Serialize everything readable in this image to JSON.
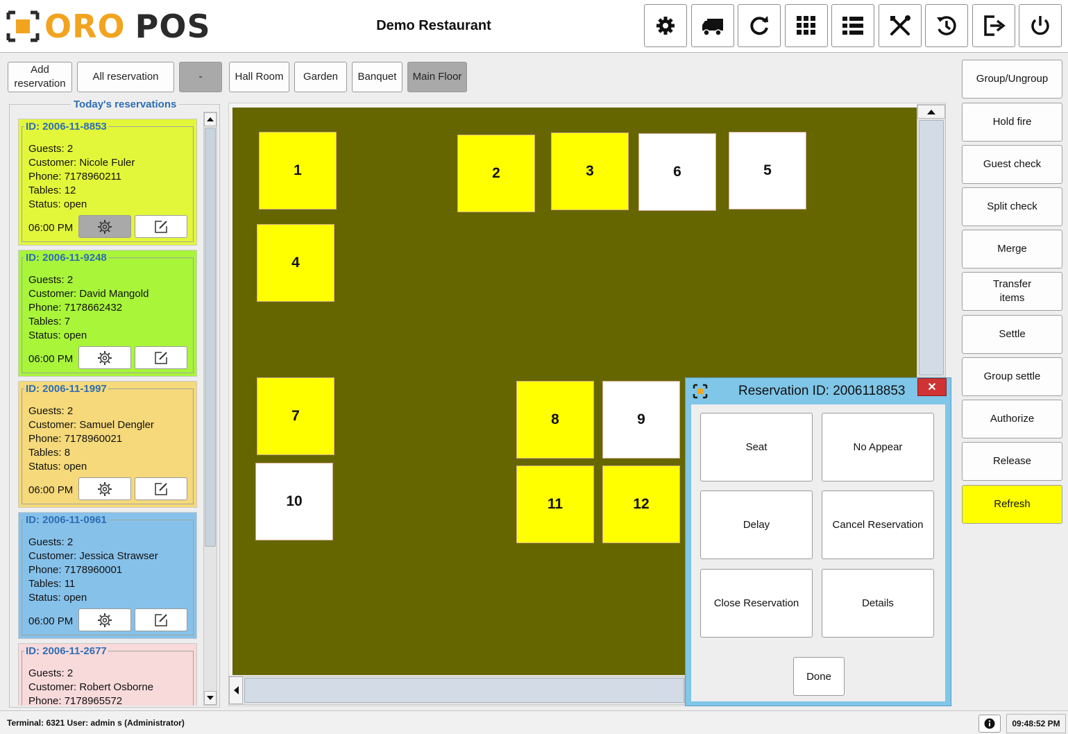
{
  "app": {
    "logo_left": "ORO",
    "logo_right": "POS",
    "restaurant": "Demo Restaurant"
  },
  "header_icons": [
    "gear-icon",
    "truck-icon",
    "refresh-icon",
    "grid-icon",
    "list-icon",
    "tools-icon",
    "clock-reset-icon",
    "logout-icon",
    "power-icon"
  ],
  "toolbar": {
    "add_reservation": "Add reservation",
    "all_reservation": "All reservation",
    "minus": "-",
    "rooms": [
      "Hall Room",
      "Garden",
      "Banquet",
      "Main Floor"
    ],
    "active_room": "Main Floor"
  },
  "reservations": {
    "title": "Today's reservations",
    "cards": [
      {
        "id": "ID: 2006-11-8853",
        "guests": "Guests: 2",
        "customer": "Customer: Nicole Fuler",
        "phone": "Phone: 7178960211",
        "tables": "Tables: 12",
        "status": "Status: open",
        "time": "06:00 PM",
        "color": "#e3f73a"
      },
      {
        "id": "ID: 2006-11-9248",
        "guests": "Guests: 2",
        "customer": "Customer: David Mangold",
        "phone": "Phone: 7178662432",
        "tables": "Tables: 7",
        "status": "Status: open",
        "time": "06:00 PM",
        "color": "#a8f53a"
      },
      {
        "id": "ID: 2006-11-1997",
        "guests": "Guests: 2",
        "customer": "Customer: Samuel Dengler",
        "phone": "Phone: 7178960021",
        "tables": "Tables: 8",
        "status": "Status: open",
        "time": "06:00 PM",
        "color": "#f5d97a"
      },
      {
        "id": "ID: 2006-11-0961",
        "guests": "Guests: 2",
        "customer": "Customer: Jessica Strawser",
        "phone": "Phone: 7178960001",
        "tables": "Tables: 11",
        "status": "Status: open",
        "time": "06:00 PM",
        "color": "#86c1ea"
      },
      {
        "id": "ID: 2006-11-2677",
        "guests": "Guests: 2",
        "customer": "Customer: Robert Osborne",
        "phone": "Phone: 7178965572",
        "tables": "",
        "status": "",
        "time": "",
        "color": "#f8dadb"
      }
    ]
  },
  "tables": [
    {
      "number": "1",
      "status": "yellow"
    },
    {
      "number": "2",
      "status": "yellow"
    },
    {
      "number": "3",
      "status": "yellow"
    },
    {
      "number": "6",
      "status": "white"
    },
    {
      "number": "5",
      "status": "white"
    },
    {
      "number": "4",
      "status": "yellow"
    },
    {
      "number": "7",
      "status": "yellow"
    },
    {
      "number": "10",
      "status": "white"
    },
    {
      "number": "8",
      "status": "yellow"
    },
    {
      "number": "9",
      "status": "white"
    },
    {
      "number": "11",
      "status": "yellow"
    },
    {
      "number": "12",
      "status": "yellow"
    }
  ],
  "sidebar": [
    "Group/Ungroup",
    "Hold fire",
    "Guest check",
    "Split check",
    "Merge",
    "Transfer items",
    "Settle",
    "Group settle",
    "Authorize",
    "Release",
    "Refresh"
  ],
  "dialog": {
    "title": "Reservation ID: 2006118853",
    "close": "✕",
    "buttons": [
      "Seat",
      "No Appear",
      "Delay",
      "Cancel Reservation",
      "Close Reservation",
      "Details"
    ],
    "done": "Done"
  },
  "status_bar": {
    "text": "Terminal: 6321  User: admin s (Administrator)",
    "time": "09:48:52 PM"
  }
}
